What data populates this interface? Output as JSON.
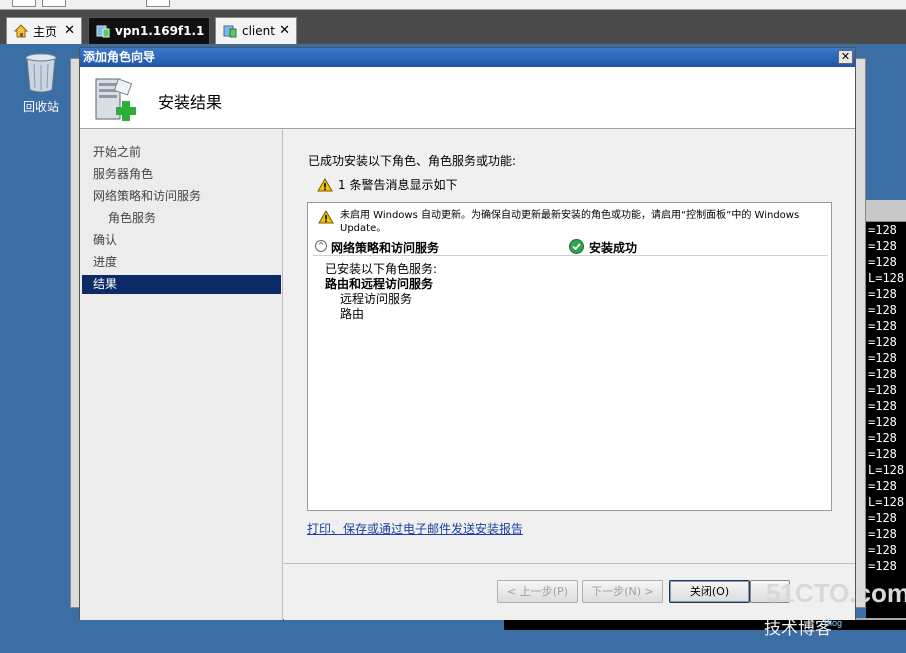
{
  "tabs": [
    {
      "label": "主页"
    },
    {
      "label": "vpn1.169f1.1"
    },
    {
      "label": "client"
    }
  ],
  "tab_close_glyph": "✕",
  "desktop": {
    "recycle_bin_label": "回收站"
  },
  "terminal": {
    "lines": [
      "=128",
      "=128",
      "=128",
      "L=128",
      "=128",
      "=128",
      "=128",
      "=128",
      "=128",
      "=128",
      "=128",
      "=128",
      "=128",
      "=128",
      "=128",
      "L=128",
      "=128",
      "L=128",
      "=128",
      "=128",
      "=128",
      "=128"
    ]
  },
  "wizard": {
    "title": "添加角色向导",
    "close_glyph": "✕",
    "header_title": "安装结果",
    "nav": [
      {
        "label": "开始之前",
        "state": "normal"
      },
      {
        "label": "服务器角色",
        "state": "normal"
      },
      {
        "label": "网络策略和访问服务",
        "state": "normal"
      },
      {
        "label": "角色服务",
        "state": "sub"
      },
      {
        "label": "确认",
        "state": "normal"
      },
      {
        "label": "进度",
        "state": "normal"
      },
      {
        "label": "结果",
        "state": "active"
      }
    ],
    "intro_text": "已成功安装以下角色、角色服务或功能:",
    "warning_summary": "1 条警告消息显示如下",
    "warning_detail": "未启用 Windows 自动更新。为确保自动更新最新安装的角色或功能，请启用“控制面板”中的 Windows Update。",
    "section_name": "网络策略和访问服务",
    "section_status": "安装成功",
    "installed_header": "已安装以下角色服务:",
    "installed_group": "路由和远程访问服务",
    "installed_items": [
      "远程访问服务",
      "路由"
    ],
    "report_link": "打印、保存或通过电子邮件发送安装报告",
    "buttons": {
      "prev": "< 上一步(P)",
      "next": "下一步(N) >",
      "close": "关闭(O)"
    }
  },
  "watermark": {
    "line1": "51CTO.com",
    "line2": "技术博客",
    "line3": "Blog"
  },
  "colors": {
    "desktop": "#3a6ea5",
    "titlebar": "#1f56a8",
    "nav_active": "#0c2a66",
    "link": "#1a3fa0",
    "success": "#2ea44f",
    "warning": "#f2c200"
  },
  "icons": {
    "home": "home-icon",
    "server_tab": "server-icon",
    "client_tab": "client-icon",
    "recycle_bin": "recycle-bin-icon",
    "wizard_header": "server-add-role-icon",
    "warning": "warning-icon",
    "success": "check-circle-icon",
    "collapse": "collapse-icon"
  }
}
